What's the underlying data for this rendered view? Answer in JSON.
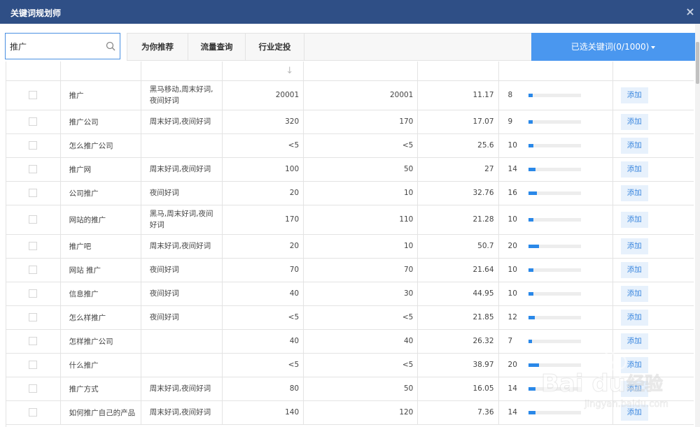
{
  "window": {
    "title": "关键词规划师",
    "close_symbol": "×"
  },
  "search": {
    "value": "推广",
    "placeholder": ""
  },
  "tabs": [
    {
      "label": "为你推荐"
    },
    {
      "label": "流量查询"
    },
    {
      "label": "行业定投"
    }
  ],
  "selected_button": {
    "label": "已选关键词(0/1000)"
  },
  "table": {
    "sort_indicator": "↓",
    "rows": [
      {
        "keyword": "推广",
        "tags": "黑马移动,周末好词,夜间好词",
        "val1": "20001",
        "val2": "20001",
        "bid": "11.17",
        "comp": "8",
        "comp_level": 0.08,
        "action": "添加"
      },
      {
        "keyword": "推广公司",
        "tags": "周末好词,夜间好词",
        "val1": "320",
        "val2": "170",
        "bid": "17.07",
        "comp": "9",
        "comp_level": 0.09,
        "action": "添加"
      },
      {
        "keyword": "怎么推广公司",
        "tags": "",
        "val1": "<5",
        "val2": "<5",
        "bid": "25.6",
        "comp": "10",
        "comp_level": 0.1,
        "action": "添加"
      },
      {
        "keyword": "推广网",
        "tags": "周末好词,夜间好词",
        "val1": "100",
        "val2": "50",
        "bid": "27",
        "comp": "14",
        "comp_level": 0.14,
        "action": "添加"
      },
      {
        "keyword": "公司推广",
        "tags": "夜间好词",
        "val1": "20",
        "val2": "10",
        "bid": "32.76",
        "comp": "16",
        "comp_level": 0.16,
        "action": "添加"
      },
      {
        "keyword": "网站的推广",
        "tags": "黑马,周末好词,夜间好词",
        "val1": "170",
        "val2": "110",
        "bid": "21.28",
        "comp": "10",
        "comp_level": 0.1,
        "action": "添加"
      },
      {
        "keyword": "推广吧",
        "tags": "周末好词,夜间好词",
        "val1": "20",
        "val2": "10",
        "bid": "50.7",
        "comp": "20",
        "comp_level": 0.2,
        "action": "添加"
      },
      {
        "keyword": "网站 推广",
        "tags": "夜间好词",
        "val1": "70",
        "val2": "70",
        "bid": "21.64",
        "comp": "10",
        "comp_level": 0.1,
        "action": "添加"
      },
      {
        "keyword": "信息推广",
        "tags": "夜间好词",
        "val1": "40",
        "val2": "30",
        "bid": "44.95",
        "comp": "10",
        "comp_level": 0.1,
        "action": "添加"
      },
      {
        "keyword": "怎么样推广",
        "tags": "夜间好词",
        "val1": "<5",
        "val2": "<5",
        "bid": "21.85",
        "comp": "12",
        "comp_level": 0.12,
        "action": "添加"
      },
      {
        "keyword": "怎样推广公司",
        "tags": "",
        "val1": "40",
        "val2": "40",
        "bid": "26.32",
        "comp": "7",
        "comp_level": 0.07,
        "action": "添加"
      },
      {
        "keyword": "什么推广",
        "tags": "",
        "val1": "<5",
        "val2": "<5",
        "bid": "38.97",
        "comp": "20",
        "comp_level": 0.2,
        "action": "添加"
      },
      {
        "keyword": "推广方式",
        "tags": "周末好词,夜间好词",
        "val1": "80",
        "val2": "50",
        "bid": "16.05",
        "comp": "14",
        "comp_level": 0.14,
        "action": "添加"
      },
      {
        "keyword": "如何推广自己的产品",
        "tags": "周末好词,夜间好词",
        "val1": "140",
        "val2": "120",
        "bid": "7.36",
        "comp": "14",
        "comp_level": 0.14,
        "action": "添加"
      }
    ]
  },
  "watermark": {
    "brand": "Bai du",
    "cn_text": "经验",
    "url": "jingyan.baidu.com"
  },
  "colors": {
    "header_bg": "#2f4f86",
    "accent": "#4a97ef",
    "bar_fill": "#2a88e8",
    "add_button_bg": "#e7f1fc"
  },
  "icons": {
    "search": "search-icon",
    "close": "close-icon"
  }
}
